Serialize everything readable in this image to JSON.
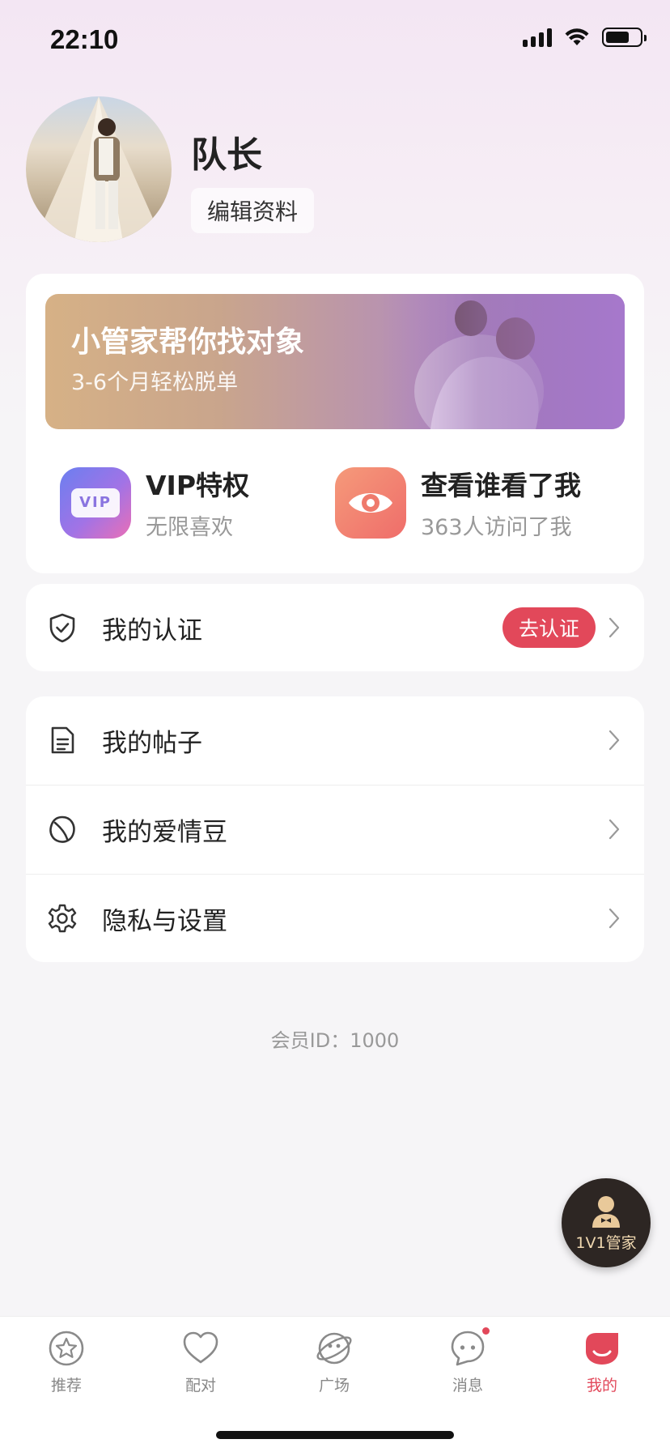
{
  "status_bar": {
    "time": "22:10"
  },
  "profile": {
    "name": "队长",
    "edit_label": "编辑资料"
  },
  "banner": {
    "title": "小管家帮你找对象",
    "subtitle": "3-6个月轻松脱单"
  },
  "features": {
    "vip": {
      "title": "VIP特权",
      "subtitle": "无限喜欢",
      "icon_text": "VIP"
    },
    "visitors": {
      "title": "查看谁看了我",
      "subtitle": "363人访问了我"
    }
  },
  "auth_row": {
    "label": "我的认证",
    "badge": "去认证"
  },
  "menu": [
    {
      "label": "我的帖子",
      "icon": "document-icon"
    },
    {
      "label": "我的爱情豆",
      "icon": "bean-icon"
    },
    {
      "label": "隐私与设置",
      "icon": "gear-icon"
    }
  ],
  "member_id": "会员ID：1000",
  "butler": {
    "label": "1V1管家"
  },
  "tabs": [
    {
      "label": "推荐",
      "icon": "star-icon"
    },
    {
      "label": "配对",
      "icon": "heart-icon"
    },
    {
      "label": "广场",
      "icon": "planet-icon"
    },
    {
      "label": "消息",
      "icon": "message-icon"
    },
    {
      "label": "我的",
      "icon": "me-icon"
    }
  ],
  "colors": {
    "accent": "#e2485a",
    "butler_bg": "#2d2623"
  }
}
